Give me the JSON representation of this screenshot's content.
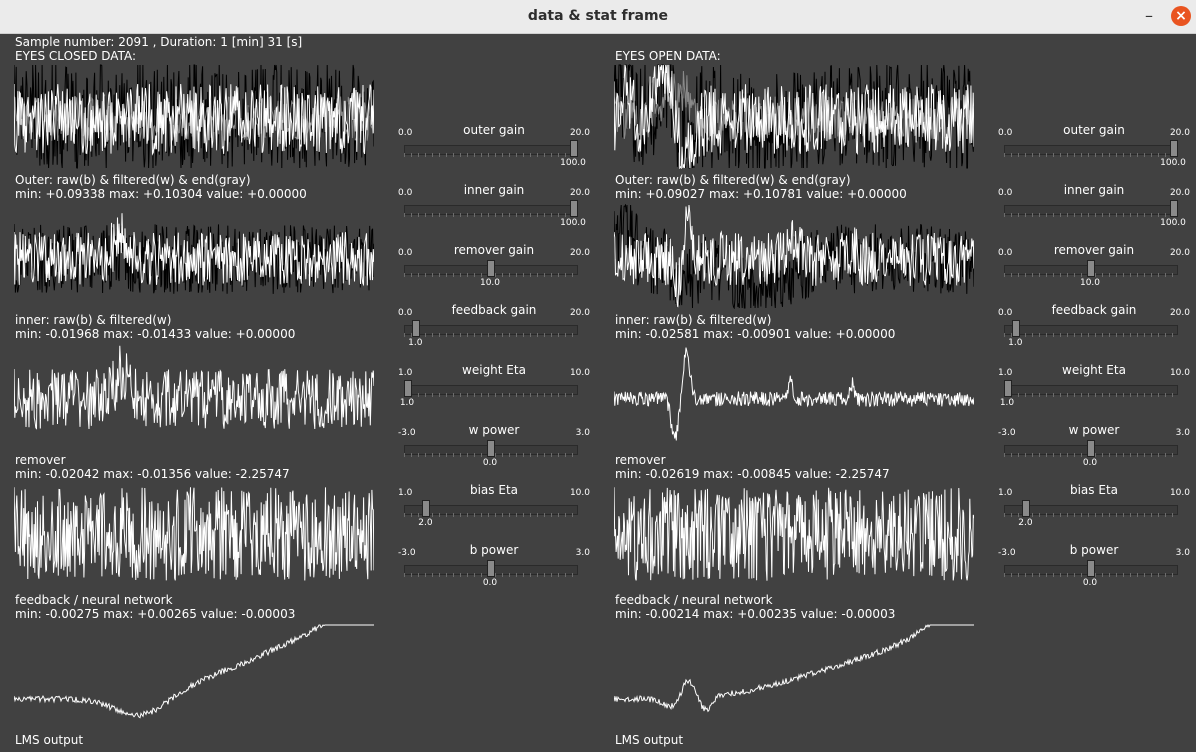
{
  "window": {
    "title": "data & stat frame"
  },
  "header": {
    "sample_info": "Sample number: 2091 , Duration: 1 [min] 31 [s]"
  },
  "panels": [
    {
      "heading": "EYES CLOSED DATA:",
      "plots": [
        {
          "label": "Outer: raw(b) & filtered(w) & end(gray)",
          "stats": "min: +0.09338 max: +0.10304 value: +0.00000"
        },
        {
          "label": "inner: raw(b) & filtered(w)",
          "stats": "min: -0.01968 max: -0.01433 value: +0.00000"
        },
        {
          "label": "remover",
          "stats": "min: -0.02042 max: -0.01356 value: -2.25747"
        },
        {
          "label": "feedback / neural network",
          "stats": "min: -0.00275 max: +0.00265 value: -0.00003"
        },
        {
          "label": "LMS output",
          "stats": ""
        }
      ],
      "sliders": [
        {
          "label": "outer gain",
          "min": "0.0",
          "max": "20.0",
          "value": "100.0",
          "fraction": 1.0
        },
        {
          "label": "inner gain",
          "min": "0.0",
          "max": "20.0",
          "value": "100.0",
          "fraction": 1.0
        },
        {
          "label": "remover gain",
          "min": "0.0",
          "max": "20.0",
          "value": "10.0",
          "fraction": 0.5
        },
        {
          "label": "feedback gain",
          "min": "0.0",
          "max": "20.0",
          "value": "1.0",
          "fraction": 0.05
        },
        {
          "label": "weight Eta",
          "min": "1.0",
          "max": "10.0",
          "value": "1.0",
          "fraction": 0.0
        },
        {
          "label": "w power",
          "min": "-3.0",
          "max": "3.0",
          "value": "0.0",
          "fraction": 0.5
        },
        {
          "label": "bias Eta",
          "min": "1.0",
          "max": "10.0",
          "value": "2.0",
          "fraction": 0.111
        },
        {
          "label": "b power",
          "min": "-3.0",
          "max": "3.0",
          "value": "0.0",
          "fraction": 0.5
        }
      ]
    },
    {
      "heading": "EYES OPEN DATA:",
      "plots": [
        {
          "label": "Outer: raw(b) & filtered(w) & end(gray)",
          "stats": "min: +0.09027 max: +0.10781 value: +0.00000"
        },
        {
          "label": "inner: raw(b) & filtered(w)",
          "stats": "min: -0.02581 max: -0.00901 value: +0.00000"
        },
        {
          "label": "remover",
          "stats": "min: -0.02619 max: -0.00845 value: -2.25747"
        },
        {
          "label": "feedback / neural network",
          "stats": "min: -0.00214 max: +0.00235 value: -0.00003"
        },
        {
          "label": "LMS output",
          "stats": ""
        }
      ],
      "sliders": [
        {
          "label": "outer gain",
          "min": "0.0",
          "max": "20.0",
          "value": "100.0",
          "fraction": 1.0
        },
        {
          "label": "inner gain",
          "min": "0.0",
          "max": "20.0",
          "value": "100.0",
          "fraction": 1.0
        },
        {
          "label": "remover gain",
          "min": "0.0",
          "max": "20.0",
          "value": "10.0",
          "fraction": 0.5
        },
        {
          "label": "feedback gain",
          "min": "0.0",
          "max": "20.0",
          "value": "1.0",
          "fraction": 0.05
        },
        {
          "label": "weight Eta",
          "min": "1.0",
          "max": "10.0",
          "value": "1.0",
          "fraction": 0.0
        },
        {
          "label": "w power",
          "min": "-3.0",
          "max": "3.0",
          "value": "0.0",
          "fraction": 0.5
        },
        {
          "label": "bias Eta",
          "min": "1.0",
          "max": "10.0",
          "value": "2.0",
          "fraction": 0.111
        },
        {
          "label": "b power",
          "min": "-3.0",
          "max": "3.0",
          "value": "0.0",
          "fraction": 0.5
        }
      ]
    }
  ],
  "colors": {
    "background": "#414141",
    "raw": "#000000",
    "filtered": "#ffffff",
    "end": "#8a8a8a"
  }
}
